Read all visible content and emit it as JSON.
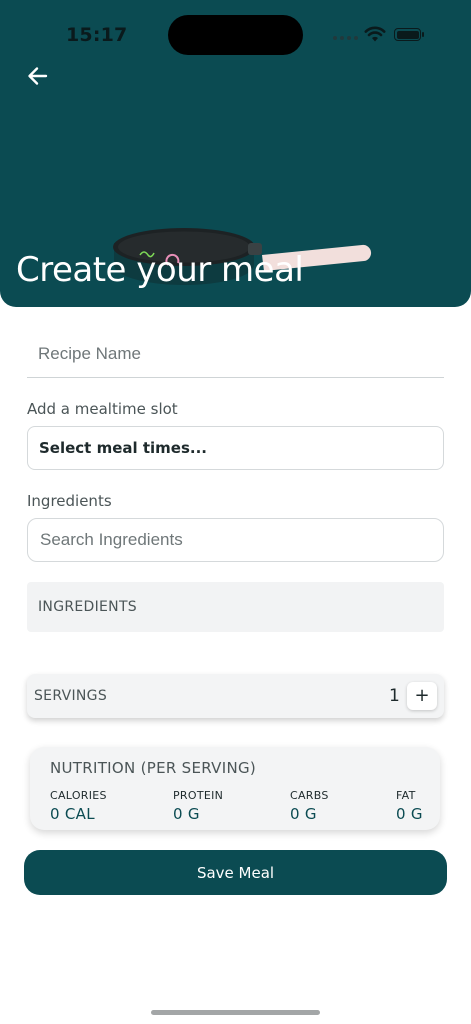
{
  "status_bar": {
    "time": "15:17"
  },
  "header": {
    "title": "Create your meal"
  },
  "form": {
    "recipe_name_placeholder": "Recipe Name",
    "mealtime_label": "Add a mealtime slot",
    "mealtime_select_value": "Select meal times...",
    "ingredients_label": "Ingredients",
    "ingredients_search_placeholder": "Search Ingredients",
    "ingredients_list_header": "INGREDIENTS"
  },
  "servings": {
    "label": "SERVINGS",
    "count": "1",
    "increment_label": "+"
  },
  "nutrition": {
    "title": "NUTRITION (PER SERVING)",
    "items": [
      {
        "label": "CALORIES",
        "value": "0 CAL"
      },
      {
        "label": "PROTEIN",
        "value": "0 G"
      },
      {
        "label": "CARBS",
        "value": "0 G"
      },
      {
        "label": "FAT",
        "value": "0 G"
      }
    ]
  },
  "actions": {
    "save_label": "Save Meal"
  },
  "colors": {
    "primary": "#0b4b52",
    "surface": "#f3f4f5",
    "pan_handle": "#f2dfdc"
  },
  "icons": [
    "back-arrow-icon",
    "signal-icon",
    "wifi-icon",
    "battery-icon",
    "frying-pan-illustration",
    "plus-icon"
  ]
}
